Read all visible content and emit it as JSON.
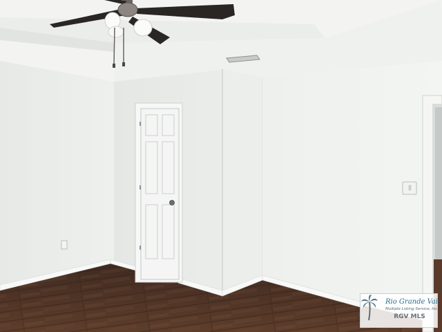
{
  "watermark": {
    "line1": "Rio Grande Valley",
    "line2": "Multiple Listing Service, Inc.",
    "line3": "RGV MLS"
  },
  "colors": {
    "wall": "#eef0ee",
    "ceiling": "#f3f4f2",
    "floor": "#5a3a2a",
    "door": "#f4f5f4",
    "fan_blade": "#2a2624"
  }
}
